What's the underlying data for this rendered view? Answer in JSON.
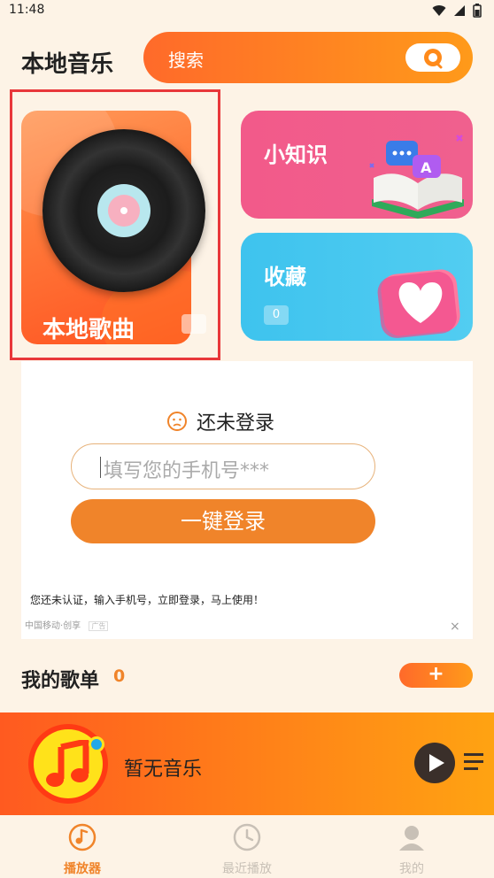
{
  "status_bar": {
    "time": "11:48"
  },
  "header": {
    "title": "本地音乐",
    "search_label": "搜索"
  },
  "cards": {
    "local_songs": {
      "label": "本地歌曲"
    },
    "tips": {
      "label": "小知识"
    },
    "favorites": {
      "label": "收藏",
      "count": "0"
    }
  },
  "login": {
    "status_text": "还未登录",
    "phone_placeholder": "填写您的手机号***",
    "login_button": "一键登录",
    "notice": "您还未认证，输入手机号，立即登录，马上使用！",
    "ad_source": "中国移动·创享",
    "ad_tag": "广告",
    "close": "×"
  },
  "playlist": {
    "title": "我的歌单",
    "count": "0",
    "add_label": "+"
  },
  "player": {
    "now_playing": "暂无音乐"
  },
  "nav": {
    "items": [
      {
        "label": "播放器",
        "active": true
      },
      {
        "label": "最近播放",
        "active": false
      },
      {
        "label": "我的",
        "active": false
      }
    ]
  },
  "colors": {
    "accent": "#f0842a",
    "brand_gradient_start": "#ff6a2a",
    "brand_gradient_end": "#ff9a1a",
    "tips_card": "#f25a8a",
    "favorites_card": "#3ec3ee",
    "highlight_border": "#e8373a"
  }
}
